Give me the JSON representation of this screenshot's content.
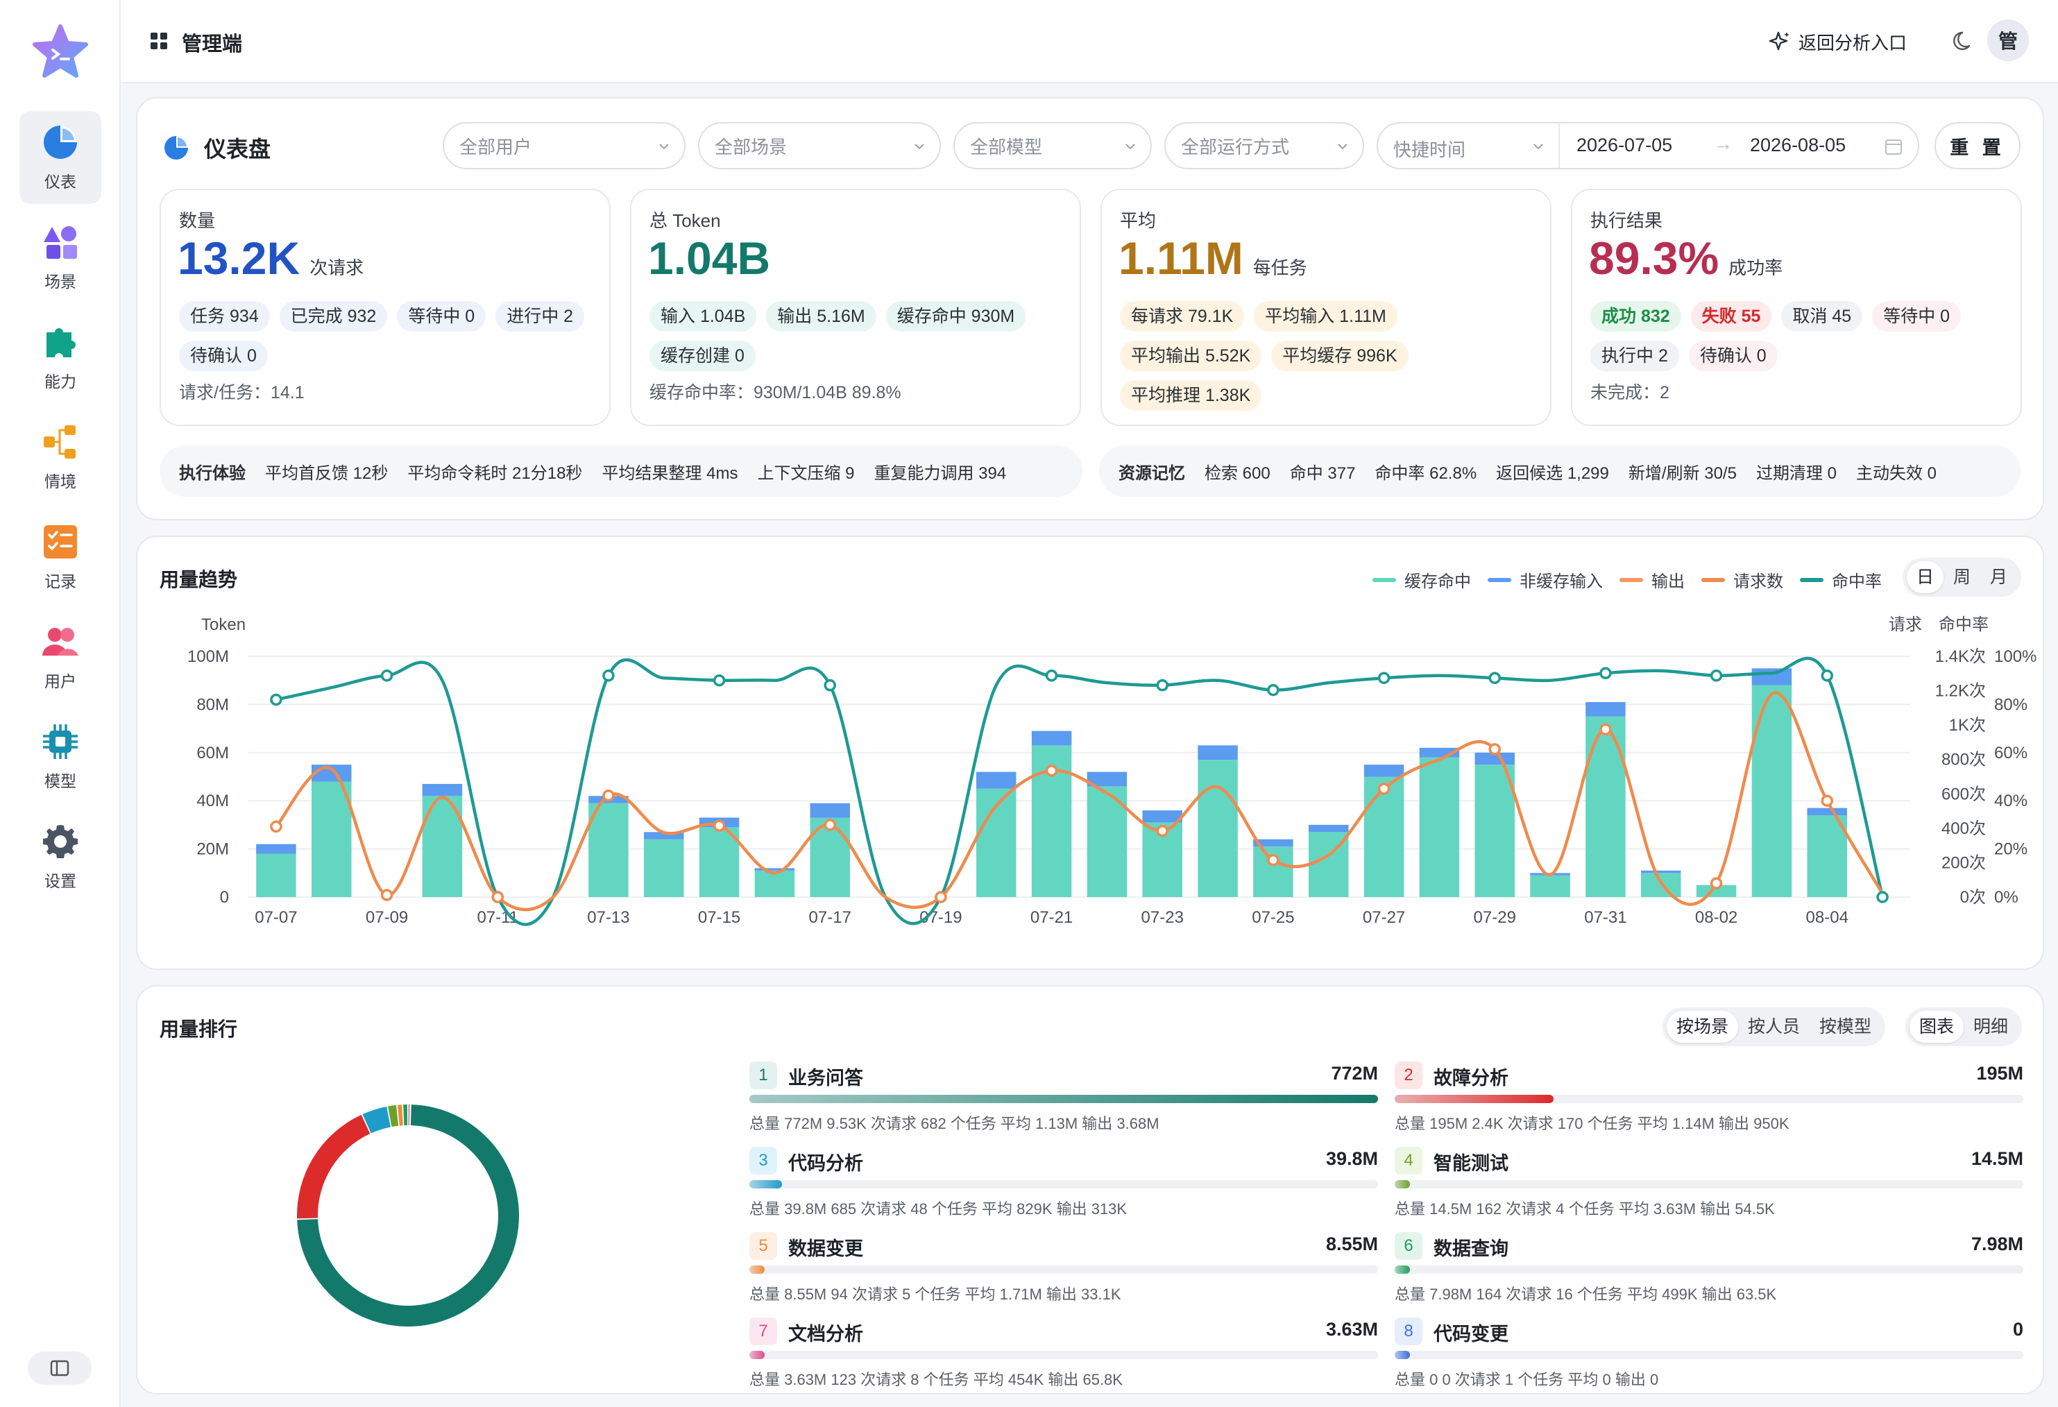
{
  "app": {
    "name": "管理端",
    "back_label": "返回分析入口",
    "avatar_text": "管"
  },
  "nav": [
    {
      "label": "仪表",
      "icon": "pie-chart-icon",
      "active": true
    },
    {
      "label": "场景",
      "icon": "shapes-icon"
    },
    {
      "label": "能力",
      "icon": "puzzle-icon"
    },
    {
      "label": "情境",
      "icon": "flow-icon"
    },
    {
      "label": "记录",
      "icon": "checklist-icon"
    },
    {
      "label": "用户",
      "icon": "users-icon"
    },
    {
      "label": "模型",
      "icon": "chip-icon"
    },
    {
      "label": "设置",
      "icon": "gear-icon"
    }
  ],
  "dashboard": {
    "title": "仪表盘",
    "filters": {
      "user": "全部用户",
      "scene": "全部场景",
      "model": "全部模型",
      "run_mode": "全部运行方式",
      "quick_time": "快捷时间"
    },
    "date_start": "2026-07-05",
    "date_arrow": "→",
    "date_end": "2026-08-05",
    "reset_label": "重 置",
    "cards": [
      {
        "label": "数量",
        "value": "13.2K",
        "unit": "次请求",
        "color": "#2253c4",
        "chips": [
          {
            "t": "任务 934"
          },
          {
            "t": "已完成 932"
          },
          {
            "t": "等待中 0"
          },
          {
            "t": "进行中 2"
          },
          {
            "t": "待确认 0"
          }
        ],
        "foot": "请求/任务：14.1"
      },
      {
        "label": "总 Token",
        "value": "1.04B",
        "unit": "",
        "color": "#137a6b",
        "chips": [
          {
            "t": "输入 1.04B"
          },
          {
            "t": "输出 5.16M"
          },
          {
            "t": "缓存命中 930M"
          },
          {
            "t": "缓存创建 0"
          }
        ],
        "foot": "缓存命中率：930M/1.04B 89.8%"
      },
      {
        "label": "平均",
        "value": "1.11M",
        "unit": "每任务",
        "color": "#b07516",
        "chips": [
          {
            "t": "每请求 79.1K"
          },
          {
            "t": "平均输入 1.11M"
          },
          {
            "t": "平均输出 5.52K"
          },
          {
            "t": "平均缓存 996K"
          },
          {
            "t": "平均推理 1.38K"
          }
        ],
        "foot": ""
      },
      {
        "label": "执行结果",
        "value": "89.3%",
        "unit": "成功率",
        "color": "#b82d52",
        "chips": [
          {
            "t": "成功 832"
          },
          {
            "t": "失败 55"
          },
          {
            "t": "取消 45"
          },
          {
            "t": "等待中 0"
          },
          {
            "t": "执行中 2"
          },
          {
            "t": "待确认 0"
          }
        ],
        "foot": "未完成：2"
      }
    ],
    "exec_strip": {
      "title": "执行体验",
      "items": [
        "平均首反馈 12秒",
        "平均命令耗时 21分18秒",
        "平均结果整理 4ms",
        "上下文压缩 9",
        "重复能力调用 394"
      ]
    },
    "memory_strip": {
      "title": "资源记忆",
      "items": [
        "检索 600",
        "命中 377",
        "命中率 62.8%",
        "返回候选 1,299",
        "新增/刷新 30/5",
        "过期清理 0",
        "主动失效 0"
      ]
    }
  },
  "trend": {
    "title": "用量趋势",
    "legend": [
      {
        "name": "缓存命中",
        "color": "#5fd4bf"
      },
      {
        "name": "非缓存输入",
        "color": "#5b9bf0"
      },
      {
        "name": "输出",
        "color": "#f29a62"
      },
      {
        "name": "请求数",
        "color": "#ee8b4d"
      },
      {
        "name": "命中率",
        "color": "#1d9a93"
      }
    ],
    "periods": [
      "日",
      "周",
      "月"
    ],
    "period_active": 0
  },
  "chart_data": {
    "type": "bar",
    "ylabel_left": "Token",
    "ylabel_right_1": "请求",
    "ylabel_right_2": "命中率",
    "ylim": [
      0,
      100
    ],
    "y_ticks": [
      "0",
      "20M",
      "40M",
      "60M",
      "80M",
      "100M"
    ],
    "y2_ticks": [
      "0次",
      "200次",
      "400次",
      "600次",
      "800次",
      "1K次",
      "1.2K次",
      "1.4K次"
    ],
    "y3_ticks": [
      "0%",
      "20%",
      "40%",
      "60%",
      "80%",
      "100%"
    ],
    "x_tick_labels": [
      "07-07",
      "07-09",
      "07-11",
      "07-13",
      "07-15",
      "07-17",
      "07-19",
      "07-21",
      "07-23",
      "07-25",
      "07-27",
      "07-29",
      "07-31",
      "08-02",
      "08-04"
    ],
    "categories": [
      "07-07",
      "07-08",
      "07-09",
      "07-10",
      "07-11",
      "07-12",
      "07-13",
      "07-14",
      "07-15",
      "07-16",
      "07-17",
      "07-18",
      "07-19",
      "07-20",
      "07-21",
      "07-22",
      "07-23",
      "07-24",
      "07-25",
      "07-26",
      "07-27",
      "07-28",
      "07-29",
      "07-30",
      "07-31",
      "08-01",
      "08-02",
      "08-03",
      "08-04",
      "08-05"
    ],
    "series": [
      {
        "name": "缓存命中",
        "unit": "M",
        "values": [
          18,
          48,
          0,
          42,
          0,
          0,
          39,
          24,
          29,
          11,
          33,
          0,
          0,
          45,
          63,
          46,
          31,
          57,
          21,
          27,
          50,
          58,
          55,
          9,
          75,
          10,
          5,
          88,
          34,
          0
        ]
      },
      {
        "name": "非缓存输入",
        "unit": "M",
        "values": [
          4,
          7,
          0,
          5,
          0,
          0,
          3,
          3,
          4,
          1,
          6,
          0,
          0,
          7,
          6,
          6,
          5,
          6,
          3,
          3,
          5,
          4,
          5,
          1,
          6,
          1,
          0,
          7,
          3,
          0
        ]
      },
      {
        "name": "请求数",
        "unit": "次",
        "values": [
          410,
          745,
          12,
          580,
          0,
          0,
          590,
          375,
          415,
          140,
          420,
          0,
          0,
          530,
          735,
          605,
          385,
          640,
          215,
          245,
          630,
          800,
          860,
          130,
          975,
          85,
          80,
          1180,
          560,
          20
        ]
      },
      {
        "name": "命中率",
        "unit": "%",
        "values": [
          82,
          87,
          92,
          90,
          0,
          0,
          92,
          91,
          90,
          90,
          88,
          0,
          0,
          88,
          92,
          89,
          88,
          90,
          86,
          89,
          91,
          92,
          91,
          90,
          93,
          94,
          92,
          93,
          92,
          0
        ]
      }
    ]
  },
  "ranking": {
    "title": "用量排行",
    "group_tabs": [
      "按场景",
      "按人员",
      "按模型"
    ],
    "group_active": 0,
    "view_tabs": [
      "图表",
      "明细"
    ],
    "view_active": 0,
    "items": [
      {
        "rank": "1",
        "name": "业务问答",
        "value": "772M",
        "pct": 100,
        "color": "#137a6b",
        "bg": "#e3f2ef",
        "meta": "总量 772M  9.53K 次请求  682 个任务  平均 1.13M  输出 3.68M"
      },
      {
        "rank": "2",
        "name": "故障分析",
        "value": "195M",
        "pct": 25.3,
        "color": "#dd2b2b",
        "bg": "#fce6e6",
        "meta": "总量 195M  2.4K 次请求  170 个任务  平均 1.14M  输出 950K"
      },
      {
        "rank": "3",
        "name": "代码分析",
        "value": "39.8M",
        "pct": 5.2,
        "color": "#1e9cc9",
        "bg": "#e1f3fa",
        "meta": "总量 39.8M  685 次请求  48 个任务  平均 829K  输出 313K"
      },
      {
        "rank": "4",
        "name": "智能测试",
        "value": "14.5M",
        "pct": 1.9,
        "color": "#6ca22a",
        "bg": "#edf6e2",
        "meta": "总量 14.5M  162 次请求  4 个任务  平均 3.63M  输出 54.5K"
      },
      {
        "rank": "5",
        "name": "数据变更",
        "value": "8.55M",
        "pct": 1.1,
        "color": "#f08a3c",
        "bg": "#fdefe3",
        "meta": "总量 8.55M  94 次请求  5 个任务  平均 1.71M  输出 33.1K"
      },
      {
        "rank": "6",
        "name": "数据查询",
        "value": "7.98M",
        "pct": 1.0,
        "color": "#1f9f5b",
        "bg": "#e3f5eb",
        "meta": "总量 7.98M  164 次请求  16 个任务  平均 499K  输出 63.5K"
      },
      {
        "rank": "7",
        "name": "文档分析",
        "value": "3.63M",
        "pct": 0.5,
        "color": "#e04a86",
        "bg": "#fce7f0",
        "meta": "总量 3.63M  123 次请求  8 个任务  平均 454K  输出 65.8K"
      },
      {
        "rank": "8",
        "name": "代码变更",
        "value": "0",
        "pct": 0.1,
        "color": "#3f6fd8",
        "bg": "#e6edfb",
        "meta": "总量 0  0 次请求  1 个任务  平均 0  输出 0"
      }
    ],
    "donut": [
      {
        "name": "业务问答",
        "value": 772,
        "color": "#137a6b"
      },
      {
        "name": "故障分析",
        "value": 195,
        "color": "#dd2b2b"
      },
      {
        "name": "代码分析",
        "value": 39.8,
        "color": "#1e9cc9"
      },
      {
        "name": "智能测试",
        "value": 14.5,
        "color": "#6ca22a"
      },
      {
        "name": "数据变更",
        "value": 8.55,
        "color": "#f08a3c"
      },
      {
        "name": "数据查询",
        "value": 7.98,
        "color": "#1f9f5b"
      },
      {
        "name": "文档分析",
        "value": 3.63,
        "color": "#e04a86"
      },
      {
        "name": "代码变更",
        "value": 0.5,
        "color": "#3f6fd8"
      }
    ]
  }
}
